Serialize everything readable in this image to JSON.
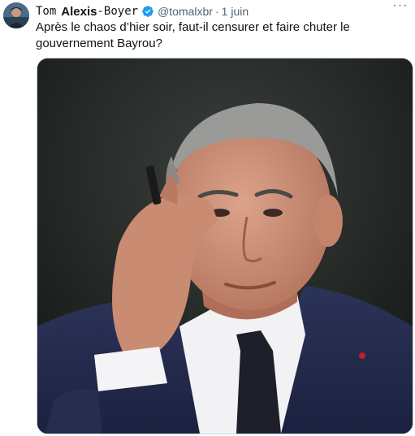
{
  "tweet": {
    "author_first": "Tom",
    "author_bold": "Alexis",
    "author_last": "-Boyer",
    "handle": "@tomalxbr",
    "separator": "·",
    "time": "1 juin",
    "more": "···",
    "text": "Après le chaos d’hier soir, faut-il censurer et faire chuter le gouvernement Bayrou?"
  },
  "icons": {
    "verified": "verified-badge-icon",
    "more": "more-icon"
  },
  "colors": {
    "accent": "#1d9bf0",
    "text": "#0f1419",
    "secondary": "#536471"
  }
}
